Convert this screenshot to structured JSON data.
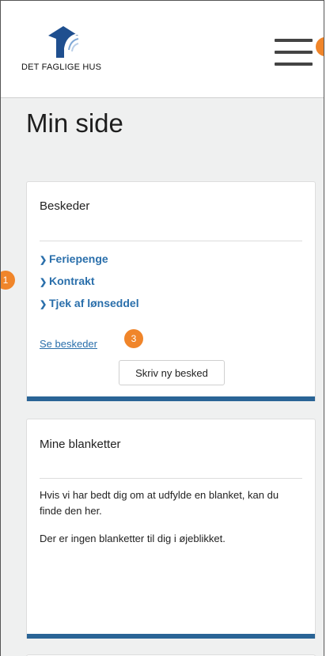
{
  "header": {
    "logo_text": "DET FAGLIGE HUS",
    "menu_icon": "hamburger-menu-icon"
  },
  "annotations": [
    "1",
    "3"
  ],
  "page_title": "Min side",
  "messages_card": {
    "title": "Beskeder",
    "links": [
      "Feriepenge",
      "Kontrakt",
      "Tjek af lønseddel"
    ],
    "see_messages_label": "Se beskeder",
    "new_message_label": "Skriv ny besked"
  },
  "forms_card": {
    "title": "Mine blanketter",
    "intro": "Hvis vi har bedt dig om at udfylde en blanket, kan du finde den her.",
    "empty_text": "Der er ingen blanketter til dig i øjeblikket."
  },
  "colors": {
    "accent": "#2a6496",
    "link": "#2a6fab",
    "annotation": "#f0852a",
    "background": "#eff0f0"
  }
}
